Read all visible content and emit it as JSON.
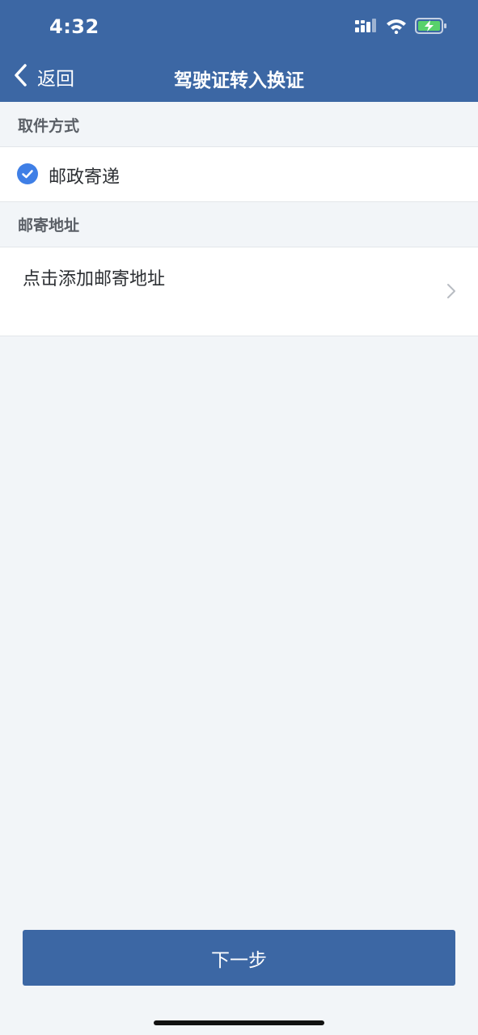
{
  "status_bar": {
    "time": "4:32",
    "icons": [
      "signal-icon",
      "wifi-icon",
      "battery-charging-icon"
    ]
  },
  "nav": {
    "back_label": "返回",
    "title": "驾驶证转入换证"
  },
  "pickup_section": {
    "header": "取件方式",
    "selected_option": "邮政寄递"
  },
  "address_section": {
    "header": "邮寄地址",
    "placeholder": "点击添加邮寄地址"
  },
  "footer": {
    "next_label": "下一步"
  },
  "colors": {
    "brand": "#3c67a4",
    "check": "#3f7fe6",
    "background": "#f2f5f8"
  }
}
